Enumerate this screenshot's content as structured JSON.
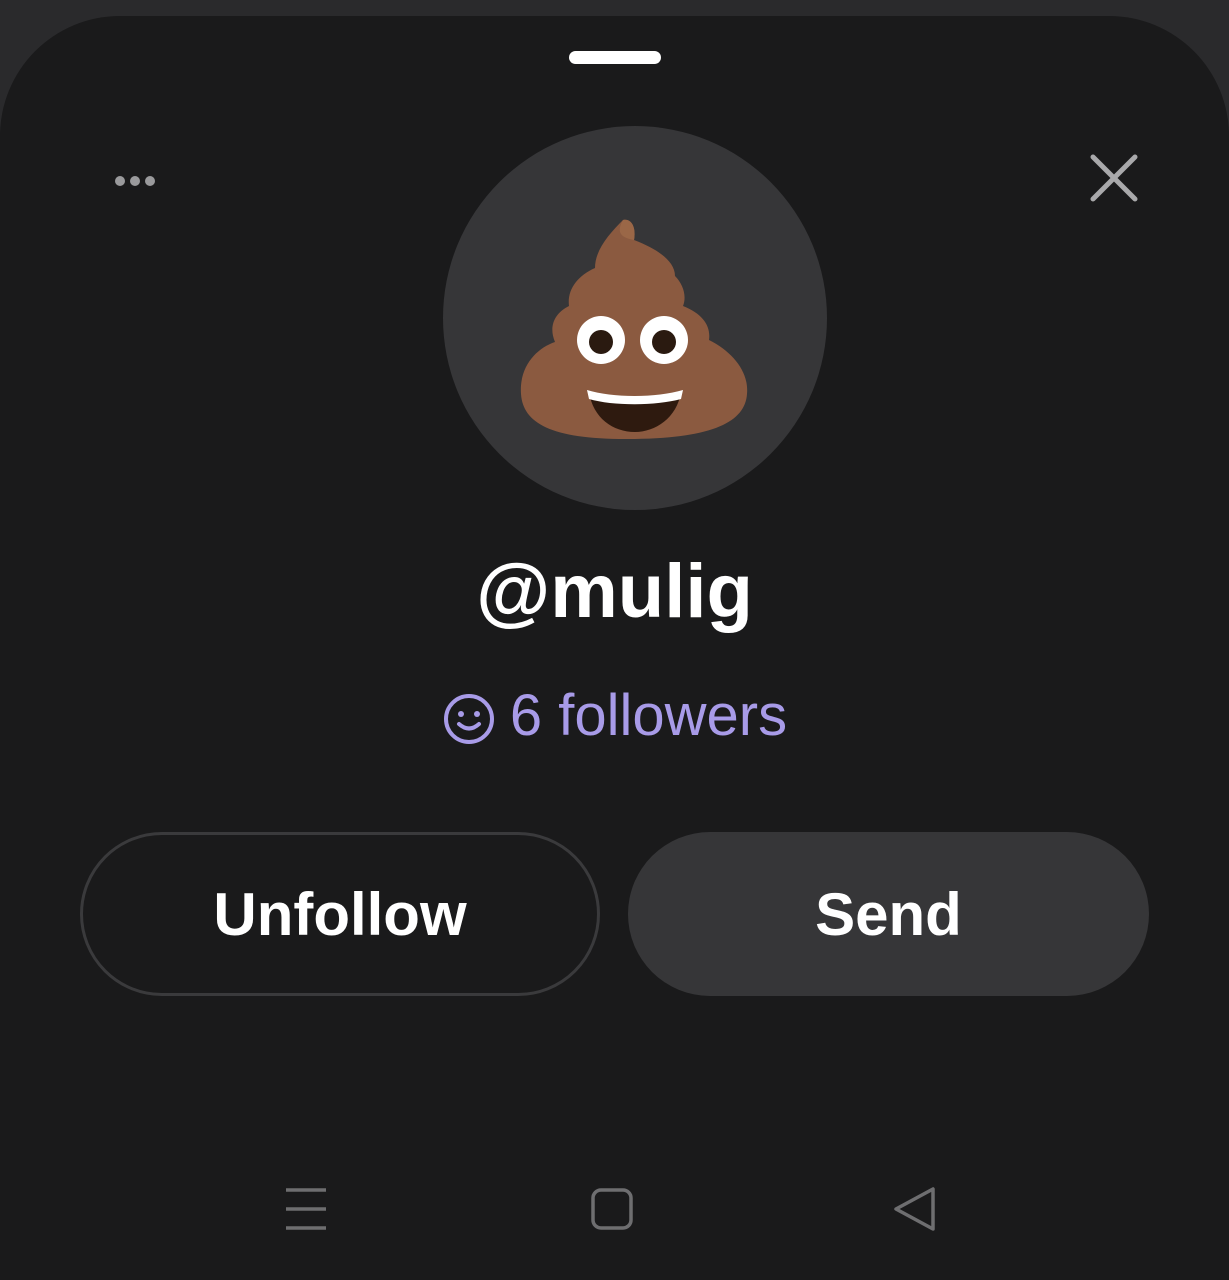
{
  "profile_sheet": {
    "username": "@mulig",
    "followers_label": "6 followers",
    "avatar_emoji": "pile-of-poo"
  },
  "actions": {
    "unfollow_label": "Unfollow",
    "send_label": "Send"
  },
  "header": {
    "more_icon": "more-horizontal-icon",
    "close_icon": "close-icon"
  },
  "navbar": {
    "items": [
      "menu-icon",
      "home-square-icon",
      "back-triangle-icon"
    ]
  },
  "colors": {
    "sheet_background": "#1a1a1b",
    "avatar_background": "#363638",
    "followers_accent": "#a89be8",
    "send_button": "#363638",
    "text_primary": "#ffffff"
  }
}
